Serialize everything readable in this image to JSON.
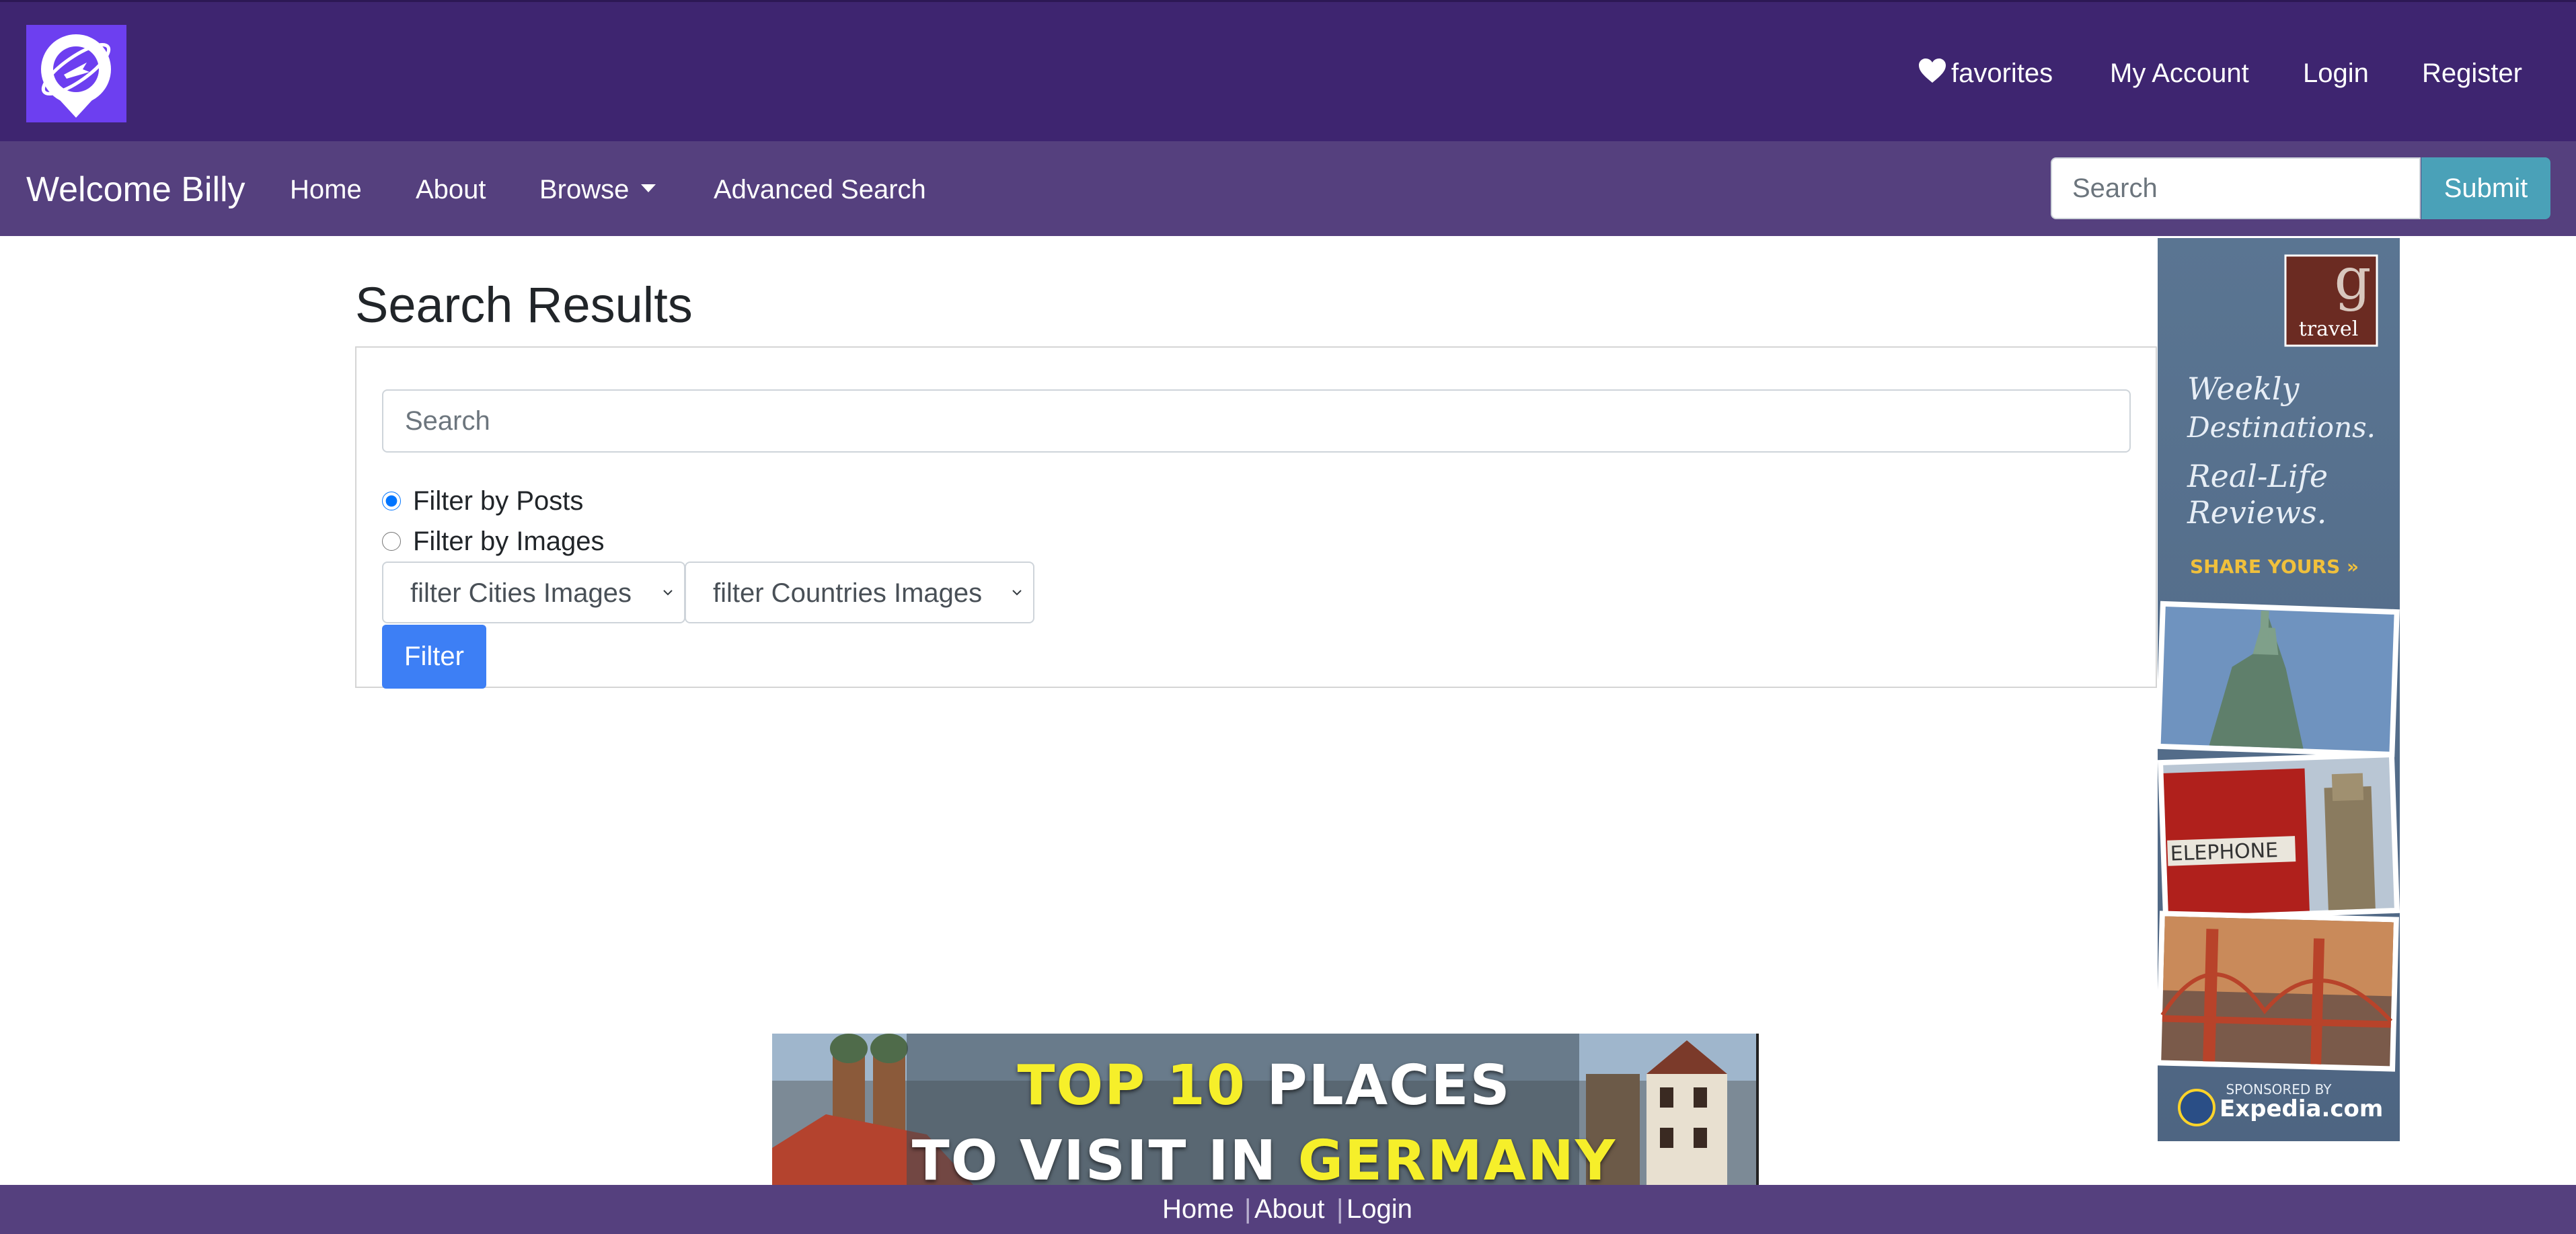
{
  "header": {
    "logo_icon": "location-pin-plane-icon",
    "favorites_icon": "heart-icon",
    "favorites_label": "favorites",
    "my_account_label": "My Account",
    "login_label": "Login",
    "register_label": "Register"
  },
  "navbar": {
    "brand": "Welcome Billy",
    "home_label": "Home",
    "about_label": "About",
    "browse_label": "Browse",
    "advanced_search_label": "Advanced Search",
    "search_placeholder": "Search",
    "submit_label": "Submit"
  },
  "main": {
    "title": "Search Results",
    "search_placeholder": "Search",
    "filters": [
      {
        "label": "Filter by Posts",
        "checked": true
      },
      {
        "label": "Filter by Images",
        "checked": false
      }
    ],
    "city_select": "filter Cities Images",
    "country_select": "filter Countries Images",
    "filter_button": "Filter"
  },
  "side_ad": {
    "brand_letter": "g",
    "brand_word": "travel",
    "line1": "Weekly",
    "line2": "Destinations.",
    "line3": "Real-Life",
    "line4": "Reviews.",
    "cta": "SHARE YOURS »",
    "photo3_text": "ELEPHONE",
    "sponsor_label": "SPONSORED BY",
    "sponsor_name": "Expedia.com"
  },
  "banner": {
    "line1_highlight": "TOP 10",
    "line1_rest": "PLACES",
    "line2_prefix": "TO VISIT IN",
    "line2_highlight": "GERMANY"
  },
  "footer": {
    "home_label": "Home",
    "about_label": "About",
    "login_label": "Login"
  },
  "colors": {
    "header_bg": "#3e2570",
    "navbar_bg": "#55407e",
    "submit_bg": "#4aa1b8",
    "filter_btn_bg": "#3d7ff5",
    "logo_bg": "#6d3ff0"
  }
}
